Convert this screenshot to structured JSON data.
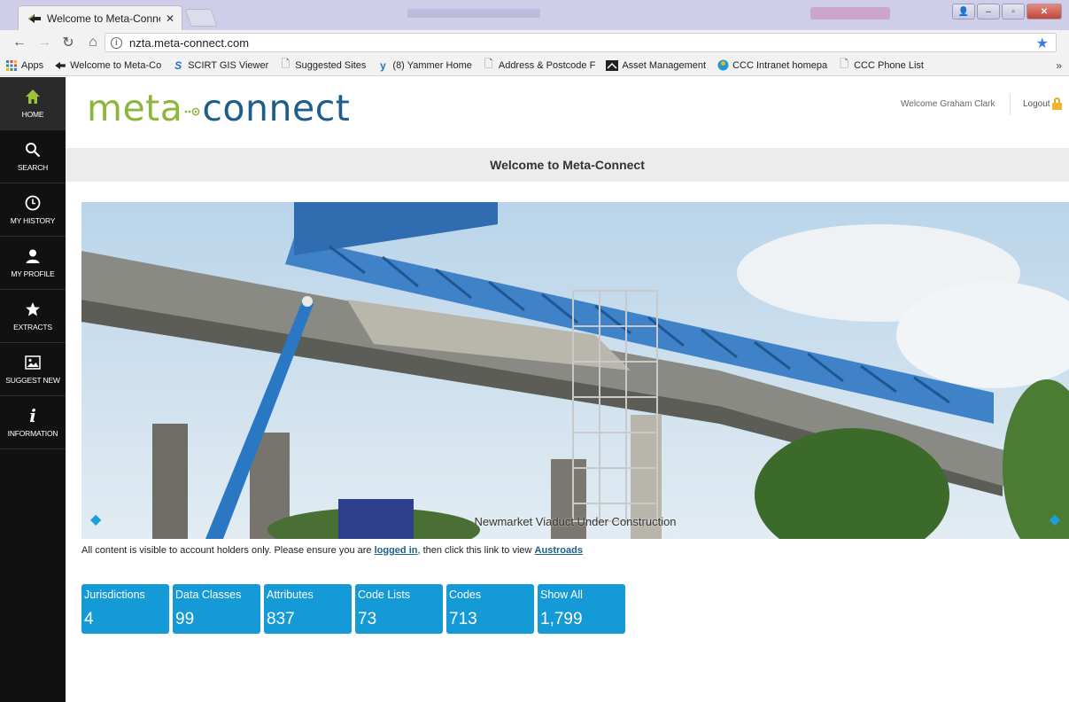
{
  "browser": {
    "tab_title": "Welcome to Meta-Conne",
    "url": "nzta.meta-connect.com"
  },
  "bookmarks": [
    {
      "label": "Apps",
      "icon": "apps-grid-icon"
    },
    {
      "label": "Welcome to Meta-Co",
      "icon": "meta-connect-favicon"
    },
    {
      "label": "SCIRT GIS Viewer",
      "icon": "scirt-favicon"
    },
    {
      "label": "Suggested Sites",
      "icon": "page-icon"
    },
    {
      "label": "(8) Yammer  Home",
      "icon": "yammer-favicon"
    },
    {
      "label": "Address & Postcode F",
      "icon": "page-icon"
    },
    {
      "label": "Asset Management",
      "icon": "asset-favicon"
    },
    {
      "label": "CCC Intranet homepa",
      "icon": "ccc-favicon"
    },
    {
      "label": "CCC Phone List",
      "icon": "page-icon"
    }
  ],
  "sidebar": {
    "items": [
      {
        "label": "HOME",
        "icon": "home-icon"
      },
      {
        "label": "SEARCH",
        "icon": "search-icon"
      },
      {
        "label": "MY HISTORY",
        "icon": "clock-icon"
      },
      {
        "label": "MY PROFILE",
        "icon": "user-icon"
      },
      {
        "label": "EXTRACTS",
        "icon": "star-icon"
      },
      {
        "label": "SUGGEST NEW",
        "icon": "image-icon"
      },
      {
        "label": "INFORMATION",
        "icon": "info-icon"
      }
    ]
  },
  "header": {
    "logo_meta": "meta",
    "logo_connect": "connect",
    "welcome_text": "Welcome Graham Clark",
    "logout_label": "Logout"
  },
  "page": {
    "title": "Welcome to Meta-Connect"
  },
  "carousel": {
    "caption": "Newmarket Viaduct Under Construction"
  },
  "notice": {
    "text_before": "All content is visible to account holders only. Please ensure you are ",
    "login_link": "logged in",
    "text_middle": ", then click this link to view ",
    "austroads_link": "Austroads"
  },
  "stats": [
    {
      "label": "Jurisdictions",
      "value": "4"
    },
    {
      "label": "Data Classes",
      "value": "99"
    },
    {
      "label": "Attributes",
      "value": "837"
    },
    {
      "label": "Code Lists",
      "value": "73"
    },
    {
      "label": "Codes",
      "value": "713"
    },
    {
      "label": "Show All",
      "value": "1,799"
    }
  ],
  "colors": {
    "brand_green": "#8cb63c",
    "brand_blue": "#1d5f8a",
    "tile_blue": "#159ad8",
    "nav_black": "#111111"
  }
}
